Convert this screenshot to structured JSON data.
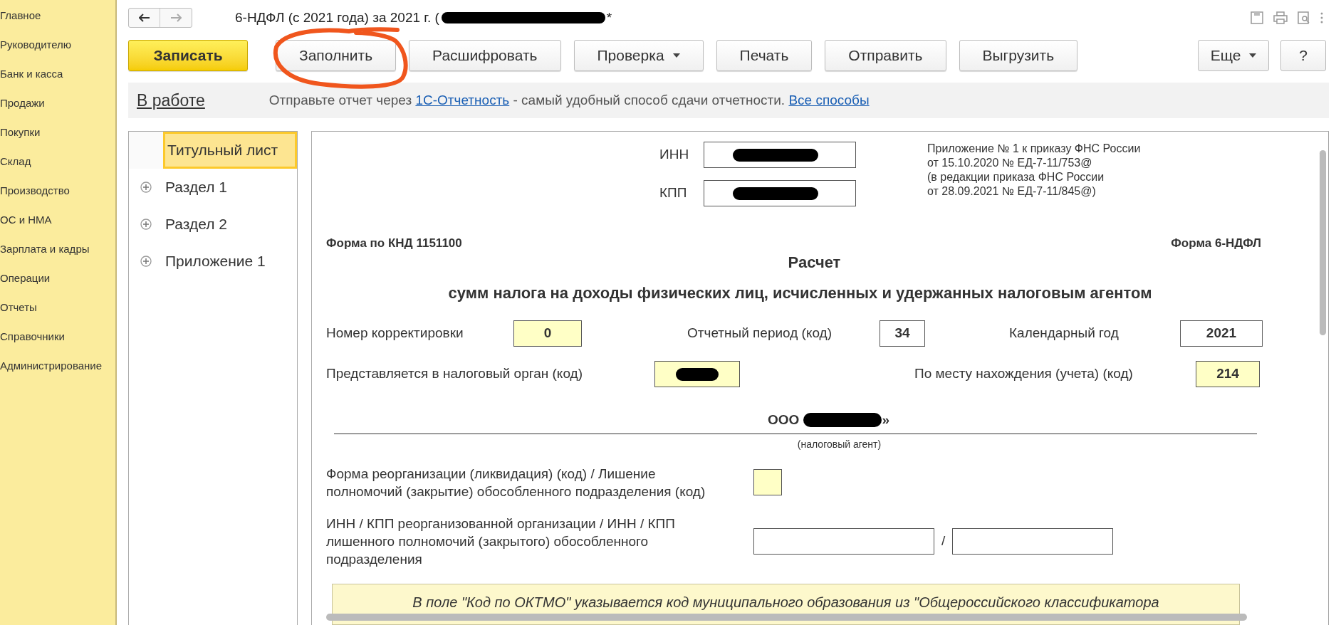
{
  "sidebar": {
    "items": [
      {
        "label": "Главное"
      },
      {
        "label": "Руководителю"
      },
      {
        "label": "Банк и касса"
      },
      {
        "label": "Продажи"
      },
      {
        "label": "Покупки"
      },
      {
        "label": "Склад"
      },
      {
        "label": "Производство"
      },
      {
        "label": "ОС и НМА"
      },
      {
        "label": "Зарплата и кадры"
      },
      {
        "label": "Операции"
      },
      {
        "label": "Отчеты"
      },
      {
        "label": "Справочники"
      },
      {
        "label": "Администрирование"
      }
    ]
  },
  "window": {
    "title": "6-НДФЛ (с 2021 года) за 2021 г. (",
    "title_redacted": true,
    "modified_mark": "*"
  },
  "toolbar": {
    "buttons": [
      {
        "label": "Записать",
        "kind": "primary"
      },
      {
        "label": "Заполнить",
        "kind": "plain",
        "annotated": true
      },
      {
        "label": "Расшифровать",
        "kind": "plain"
      },
      {
        "label": "Проверка",
        "kind": "dropdown"
      },
      {
        "label": "Печать",
        "kind": "plain"
      },
      {
        "label": "Отправить",
        "kind": "plain"
      },
      {
        "label": "Выгрузить",
        "kind": "plain"
      }
    ],
    "more": "Еще",
    "help": "?"
  },
  "info_bar": {
    "status": "В работе",
    "message_before": "Отправьте отчет через",
    "link": "1С-Отчетность",
    "message_after": "- самый удобный способ сдачи отчетности.",
    "link_all": "Все способы"
  },
  "tree": [
    {
      "label": "Титульный лист",
      "selected": true,
      "expandable": false
    },
    {
      "label": "Раздел 1",
      "selected": false,
      "expandable": true
    },
    {
      "label": "Раздел 2",
      "selected": false,
      "expandable": true
    },
    {
      "label": "Приложение 1",
      "selected": false,
      "expandable": true
    }
  ],
  "form": {
    "inn": {
      "label": "ИНН",
      "redacted": true
    },
    "kpp": {
      "label": "КПП",
      "redacted": true
    },
    "appendix_note": [
      "Приложение № 1 к приказу ФНС России",
      "от 15.10.2020 № ЕД-7-11/753@",
      "(в редакции приказа ФНС России",
      "от 28.09.2021 № ЕД-7-11/845@)"
    ],
    "knd": "Форма по КНД 1151100",
    "form_name": "Форма 6-НДФЛ",
    "title": "Расчет",
    "subtitle": "сумм налога на доходы физических лиц, исчисленных и удержанных налоговым агентом",
    "correction": {
      "label": "Номер корректировки",
      "value": "0",
      "highlighted": true
    },
    "period": {
      "label": "Отчетный период (код)",
      "value": "34",
      "highlighted": false
    },
    "year": {
      "label": "Календарный год",
      "value": "2021",
      "highlighted": false
    },
    "tax_authority": {
      "label": "Представляется в налоговый орган (код)",
      "highlighted": true,
      "redacted": true
    },
    "location": {
      "label": "По месту нахождения (учета) (код)",
      "value": "214",
      "highlighted": true
    },
    "agent": {
      "name": "ООО",
      "redacted": true,
      "suffix": "»",
      "caption": "(налоговый агент)"
    },
    "reorg": {
      "label": "Форма реорганизации (ликвидация) (код) / Лишение полномочий (закрытие) обособленного подразделения (код)",
      "highlighted": true
    },
    "reorg_inn": {
      "label": "ИНН / КПП реорганизованной организации / ИНН / КПП лишенного полномочий (закрытого) обособленного подразделения",
      "separator": "/"
    },
    "hint": "В поле \"Код по ОКТМО\" указывается код муниципального образования из \"Общероссийского классификатора"
  }
}
